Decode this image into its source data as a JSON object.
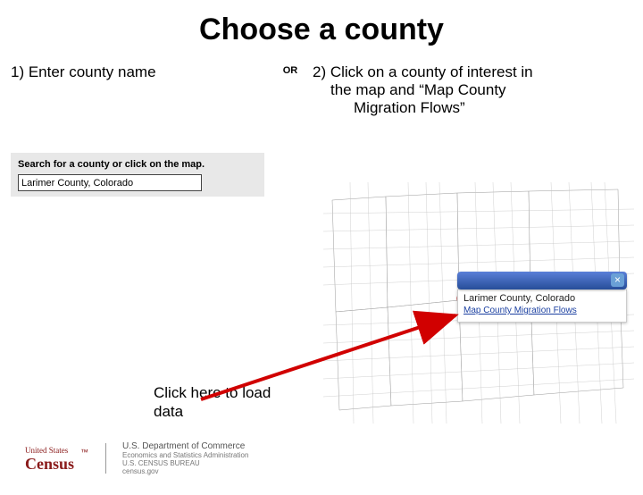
{
  "title": "Choose a county",
  "separator": "OR",
  "instructions": {
    "enter": "1) Enter county name",
    "click1": "2) Click on a county of interest in",
    "click2": "the map and “Map County",
    "click3": "Migration Flows”"
  },
  "search": {
    "label": "Search for a county or click on the map.",
    "value": "Larimer County, Colorado"
  },
  "load_note_l1": "Click here to load",
  "load_note_l2": "data",
  "popup": {
    "county_name": "Larimer County, Colorado",
    "link_text": "Map County Migration Flows",
    "close": "×"
  },
  "footer": {
    "logo_l1": "United States",
    "logo_l2": "Census",
    "dept": "U.S. Department of Commerce",
    "sub1": "Economics and Statistics Administration",
    "sub2": "U.S. CENSUS BUREAU",
    "site": "census.gov"
  }
}
